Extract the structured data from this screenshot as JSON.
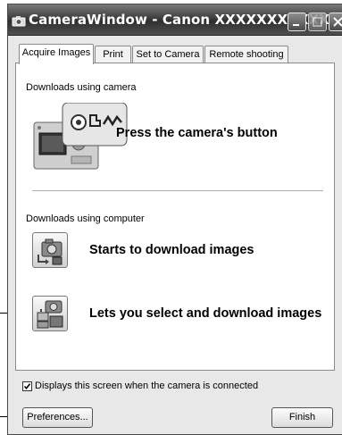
{
  "window": {
    "title": "CameraWindow - Canon XXXXXXXXXXX"
  },
  "tabs": [
    {
      "label": "Acquire Images",
      "active": true
    },
    {
      "label": "Print",
      "active": false
    },
    {
      "label": "Set to Camera",
      "active": false
    },
    {
      "label": "Remote shooting",
      "active": false
    }
  ],
  "camera_section": {
    "heading": "Downloads using camera",
    "action_label": "Press the camera's button"
  },
  "computer_section": {
    "heading": "Downloads using computer",
    "actions": [
      {
        "label": "Starts to download images",
        "icon": "camera-download-icon"
      },
      {
        "label": "Lets you select and download images",
        "icon": "select-images-icon"
      }
    ]
  },
  "startup_checkbox": {
    "label": "Displays this screen when the camera is connected",
    "checked": true
  },
  "buttons": {
    "preferences": "Preferences...",
    "finish": "Finish"
  },
  "colors": {
    "titlebar": "#3e3e3e",
    "window_bg": "#e8e8e8",
    "panel_bg": "#ffffff"
  }
}
